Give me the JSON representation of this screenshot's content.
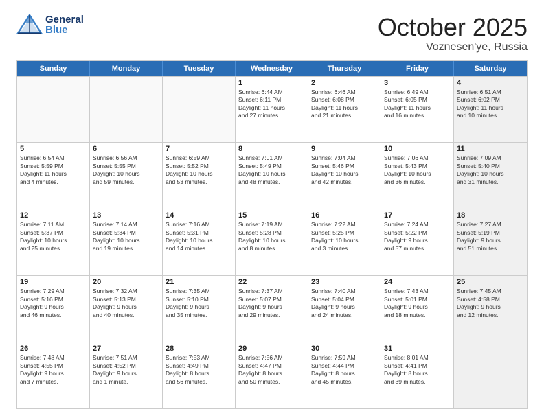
{
  "header": {
    "logo_general": "General",
    "logo_blue": "Blue",
    "title": "October 2025",
    "subtitle": "Voznesen'ye, Russia"
  },
  "weekdays": [
    "Sunday",
    "Monday",
    "Tuesday",
    "Wednesday",
    "Thursday",
    "Friday",
    "Saturday"
  ],
  "weeks": [
    [
      {
        "day": "",
        "lines": [],
        "shaded": false,
        "empty": true
      },
      {
        "day": "",
        "lines": [],
        "shaded": false,
        "empty": true
      },
      {
        "day": "",
        "lines": [],
        "shaded": false,
        "empty": true
      },
      {
        "day": "1",
        "lines": [
          "Sunrise: 6:44 AM",
          "Sunset: 6:11 PM",
          "Daylight: 11 hours",
          "and 27 minutes."
        ],
        "shaded": false,
        "empty": false
      },
      {
        "day": "2",
        "lines": [
          "Sunrise: 6:46 AM",
          "Sunset: 6:08 PM",
          "Daylight: 11 hours",
          "and 21 minutes."
        ],
        "shaded": false,
        "empty": false
      },
      {
        "day": "3",
        "lines": [
          "Sunrise: 6:49 AM",
          "Sunset: 6:05 PM",
          "Daylight: 11 hours",
          "and 16 minutes."
        ],
        "shaded": false,
        "empty": false
      },
      {
        "day": "4",
        "lines": [
          "Sunrise: 6:51 AM",
          "Sunset: 6:02 PM",
          "Daylight: 11 hours",
          "and 10 minutes."
        ],
        "shaded": true,
        "empty": false
      }
    ],
    [
      {
        "day": "5",
        "lines": [
          "Sunrise: 6:54 AM",
          "Sunset: 5:59 PM",
          "Daylight: 11 hours",
          "and 4 minutes."
        ],
        "shaded": false,
        "empty": false
      },
      {
        "day": "6",
        "lines": [
          "Sunrise: 6:56 AM",
          "Sunset: 5:55 PM",
          "Daylight: 10 hours",
          "and 59 minutes."
        ],
        "shaded": false,
        "empty": false
      },
      {
        "day": "7",
        "lines": [
          "Sunrise: 6:59 AM",
          "Sunset: 5:52 PM",
          "Daylight: 10 hours",
          "and 53 minutes."
        ],
        "shaded": false,
        "empty": false
      },
      {
        "day": "8",
        "lines": [
          "Sunrise: 7:01 AM",
          "Sunset: 5:49 PM",
          "Daylight: 10 hours",
          "and 48 minutes."
        ],
        "shaded": false,
        "empty": false
      },
      {
        "day": "9",
        "lines": [
          "Sunrise: 7:04 AM",
          "Sunset: 5:46 PM",
          "Daylight: 10 hours",
          "and 42 minutes."
        ],
        "shaded": false,
        "empty": false
      },
      {
        "day": "10",
        "lines": [
          "Sunrise: 7:06 AM",
          "Sunset: 5:43 PM",
          "Daylight: 10 hours",
          "and 36 minutes."
        ],
        "shaded": false,
        "empty": false
      },
      {
        "day": "11",
        "lines": [
          "Sunrise: 7:09 AM",
          "Sunset: 5:40 PM",
          "Daylight: 10 hours",
          "and 31 minutes."
        ],
        "shaded": true,
        "empty": false
      }
    ],
    [
      {
        "day": "12",
        "lines": [
          "Sunrise: 7:11 AM",
          "Sunset: 5:37 PM",
          "Daylight: 10 hours",
          "and 25 minutes."
        ],
        "shaded": false,
        "empty": false
      },
      {
        "day": "13",
        "lines": [
          "Sunrise: 7:14 AM",
          "Sunset: 5:34 PM",
          "Daylight: 10 hours",
          "and 19 minutes."
        ],
        "shaded": false,
        "empty": false
      },
      {
        "day": "14",
        "lines": [
          "Sunrise: 7:16 AM",
          "Sunset: 5:31 PM",
          "Daylight: 10 hours",
          "and 14 minutes."
        ],
        "shaded": false,
        "empty": false
      },
      {
        "day": "15",
        "lines": [
          "Sunrise: 7:19 AM",
          "Sunset: 5:28 PM",
          "Daylight: 10 hours",
          "and 8 minutes."
        ],
        "shaded": false,
        "empty": false
      },
      {
        "day": "16",
        "lines": [
          "Sunrise: 7:22 AM",
          "Sunset: 5:25 PM",
          "Daylight: 10 hours",
          "and 3 minutes."
        ],
        "shaded": false,
        "empty": false
      },
      {
        "day": "17",
        "lines": [
          "Sunrise: 7:24 AM",
          "Sunset: 5:22 PM",
          "Daylight: 9 hours",
          "and 57 minutes."
        ],
        "shaded": false,
        "empty": false
      },
      {
        "day": "18",
        "lines": [
          "Sunrise: 7:27 AM",
          "Sunset: 5:19 PM",
          "Daylight: 9 hours",
          "and 51 minutes."
        ],
        "shaded": true,
        "empty": false
      }
    ],
    [
      {
        "day": "19",
        "lines": [
          "Sunrise: 7:29 AM",
          "Sunset: 5:16 PM",
          "Daylight: 9 hours",
          "and 46 minutes."
        ],
        "shaded": false,
        "empty": false
      },
      {
        "day": "20",
        "lines": [
          "Sunrise: 7:32 AM",
          "Sunset: 5:13 PM",
          "Daylight: 9 hours",
          "and 40 minutes."
        ],
        "shaded": false,
        "empty": false
      },
      {
        "day": "21",
        "lines": [
          "Sunrise: 7:35 AM",
          "Sunset: 5:10 PM",
          "Daylight: 9 hours",
          "and 35 minutes."
        ],
        "shaded": false,
        "empty": false
      },
      {
        "day": "22",
        "lines": [
          "Sunrise: 7:37 AM",
          "Sunset: 5:07 PM",
          "Daylight: 9 hours",
          "and 29 minutes."
        ],
        "shaded": false,
        "empty": false
      },
      {
        "day": "23",
        "lines": [
          "Sunrise: 7:40 AM",
          "Sunset: 5:04 PM",
          "Daylight: 9 hours",
          "and 24 minutes."
        ],
        "shaded": false,
        "empty": false
      },
      {
        "day": "24",
        "lines": [
          "Sunrise: 7:43 AM",
          "Sunset: 5:01 PM",
          "Daylight: 9 hours",
          "and 18 minutes."
        ],
        "shaded": false,
        "empty": false
      },
      {
        "day": "25",
        "lines": [
          "Sunrise: 7:45 AM",
          "Sunset: 4:58 PM",
          "Daylight: 9 hours",
          "and 12 minutes."
        ],
        "shaded": true,
        "empty": false
      }
    ],
    [
      {
        "day": "26",
        "lines": [
          "Sunrise: 7:48 AM",
          "Sunset: 4:55 PM",
          "Daylight: 9 hours",
          "and 7 minutes."
        ],
        "shaded": false,
        "empty": false
      },
      {
        "day": "27",
        "lines": [
          "Sunrise: 7:51 AM",
          "Sunset: 4:52 PM",
          "Daylight: 9 hours",
          "and 1 minute."
        ],
        "shaded": false,
        "empty": false
      },
      {
        "day": "28",
        "lines": [
          "Sunrise: 7:53 AM",
          "Sunset: 4:49 PM",
          "Daylight: 8 hours",
          "and 56 minutes."
        ],
        "shaded": false,
        "empty": false
      },
      {
        "day": "29",
        "lines": [
          "Sunrise: 7:56 AM",
          "Sunset: 4:47 PM",
          "Daylight: 8 hours",
          "and 50 minutes."
        ],
        "shaded": false,
        "empty": false
      },
      {
        "day": "30",
        "lines": [
          "Sunrise: 7:59 AM",
          "Sunset: 4:44 PM",
          "Daylight: 8 hours",
          "and 45 minutes."
        ],
        "shaded": false,
        "empty": false
      },
      {
        "day": "31",
        "lines": [
          "Sunrise: 8:01 AM",
          "Sunset: 4:41 PM",
          "Daylight: 8 hours",
          "and 39 minutes."
        ],
        "shaded": false,
        "empty": false
      },
      {
        "day": "",
        "lines": [],
        "shaded": true,
        "empty": true
      }
    ]
  ]
}
